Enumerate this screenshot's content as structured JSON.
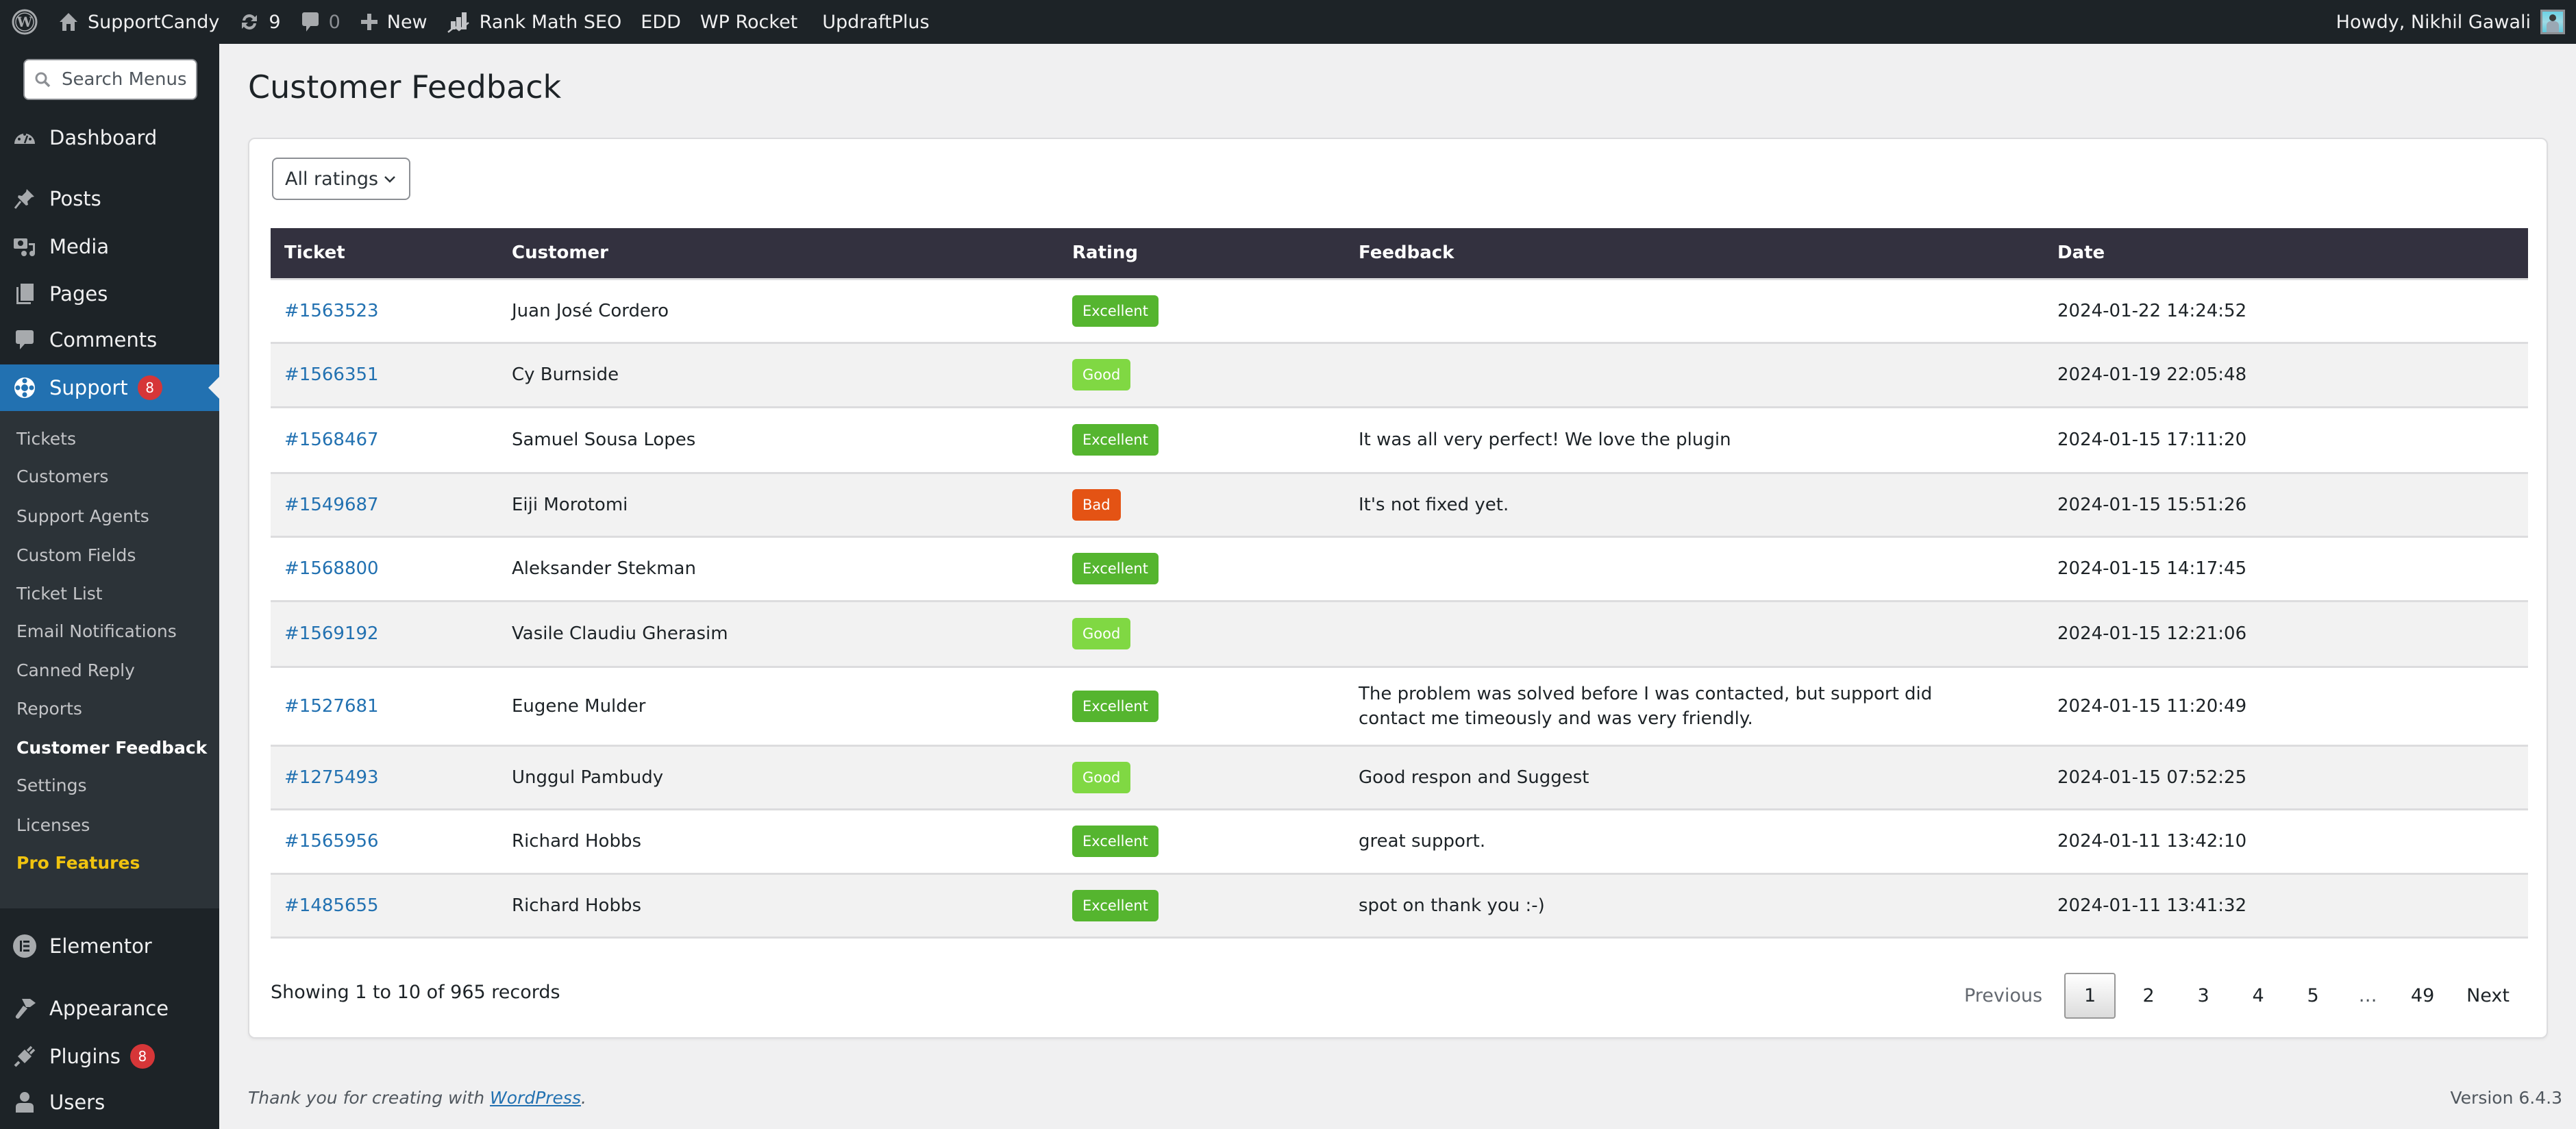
{
  "adminbar": {
    "site_name": "SupportCandy",
    "updates_count": "9",
    "comments_count": "0",
    "new_label": "New",
    "plugins": [
      "Rank Math SEO",
      "EDD",
      "WP Rocket",
      "UpdraftPlus"
    ],
    "greeting": "Howdy, Nikhil Gawali"
  },
  "sidebar": {
    "search_placeholder": "Search Menus",
    "items": [
      {
        "label": "Dashboard",
        "icon": "dashboard-icon"
      },
      {
        "label": "Posts",
        "icon": "pin-icon"
      },
      {
        "label": "Media",
        "icon": "media-icon"
      },
      {
        "label": "Pages",
        "icon": "pages-icon"
      },
      {
        "label": "Comments",
        "icon": "comment-icon"
      },
      {
        "label": "Support",
        "icon": "lifebuoy-icon",
        "badge": "8",
        "active": true
      }
    ],
    "submenu": [
      {
        "label": "Tickets"
      },
      {
        "label": "Customers"
      },
      {
        "label": "Support Agents"
      },
      {
        "label": "Custom Fields"
      },
      {
        "label": "Ticket List"
      },
      {
        "label": "Email Notifications"
      },
      {
        "label": "Canned Reply"
      },
      {
        "label": "Reports"
      },
      {
        "label": "Customer Feedback",
        "current": true
      },
      {
        "label": "Settings"
      },
      {
        "label": "Licenses"
      },
      {
        "label": "Pro Features",
        "highlight_color": "#f0c30f"
      }
    ],
    "bottom_items": [
      {
        "label": "Elementor",
        "icon": "elementor-icon"
      },
      {
        "label": "Appearance",
        "icon": "paintbrush-icon"
      },
      {
        "label": "Plugins",
        "icon": "plugin-icon",
        "badge": "8"
      },
      {
        "label": "Users",
        "icon": "user-icon"
      }
    ]
  },
  "page": {
    "title": "Customer Feedback",
    "filter": {
      "selected": "All ratings"
    }
  },
  "table": {
    "columns": [
      "Ticket",
      "Customer",
      "Rating",
      "Feedback",
      "Date"
    ],
    "rows": [
      {
        "ticket": "#1563523",
        "customer": "Juan José Cordero",
        "rating": "Excellent",
        "feedback": "",
        "date": "2024-01-22 14:24:52"
      },
      {
        "ticket": "#1566351",
        "customer": "Cy Burnside",
        "rating": "Good",
        "feedback": "",
        "date": "2024-01-19 22:05:48"
      },
      {
        "ticket": "#1568467",
        "customer": "Samuel Sousa Lopes",
        "rating": "Excellent",
        "feedback": "It was all very perfect! We love the plugin",
        "date": "2024-01-15 17:11:20"
      },
      {
        "ticket": "#1549687",
        "customer": "Eiji Morotomi",
        "rating": "Bad",
        "feedback": "It's not fixed yet.",
        "date": "2024-01-15 15:51:26"
      },
      {
        "ticket": "#1568800",
        "customer": "Aleksander Stekman",
        "rating": "Excellent",
        "feedback": "",
        "date": "2024-01-15 14:17:45"
      },
      {
        "ticket": "#1569192",
        "customer": "Vasile Claudiu Gherasim",
        "rating": "Good",
        "feedback": "",
        "date": "2024-01-15 12:21:06"
      },
      {
        "ticket": "#1527681",
        "customer": "Eugene Mulder",
        "rating": "Excellent",
        "feedback": "The problem was solved before I was contacted, but support did contact me timeously and was very friendly.",
        "date": "2024-01-15 11:20:49"
      },
      {
        "ticket": "#1275493",
        "customer": "Unggul Pambudy",
        "rating": "Good",
        "feedback": "Good respon and Suggest",
        "date": "2024-01-15 07:52:25"
      },
      {
        "ticket": "#1565956",
        "customer": "Richard Hobbs",
        "rating": "Excellent",
        "feedback": "great support.",
        "date": "2024-01-11 13:42:10"
      },
      {
        "ticket": "#1485655",
        "customer": "Richard Hobbs",
        "rating": "Excellent",
        "feedback": "spot on thank you :-)",
        "date": "2024-01-11 13:41:32"
      }
    ],
    "rating_colors": {
      "Excellent": "#55b52f",
      "Good": "#80d843",
      "Bad": "#e45314"
    }
  },
  "pagination": {
    "summary": "Showing 1 to 10 of 965 records",
    "previous": "Previous",
    "pages": [
      "1",
      "2",
      "3",
      "4",
      "5",
      "…",
      "49"
    ],
    "current": "1",
    "next": "Next"
  },
  "footer": {
    "thanks_prefix": "Thank you for creating with ",
    "thanks_link": "WordPress",
    "thanks_suffix": ".",
    "version": "Version 6.4.3"
  },
  "colors": {
    "accent": "#2271b1",
    "adminbar_bg": "#1d2327",
    "submenu_bg": "#2c3338",
    "table_header_bg": "#33313f",
    "badge_red": "#d63638"
  }
}
